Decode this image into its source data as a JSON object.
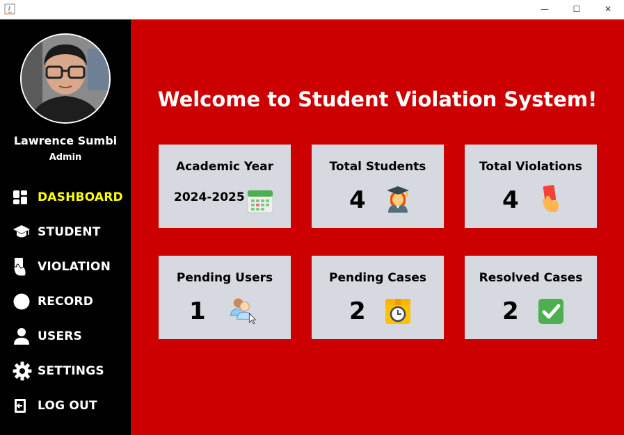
{
  "window": {
    "minimize_glyph": "—",
    "maximize_glyph": "☐",
    "close_glyph": "✕"
  },
  "sidebar": {
    "user_name": "Lawrence Sumbi",
    "user_role": "Admin",
    "items": [
      {
        "label": "DASHBOARD",
        "icon": "dashboard-icon",
        "active": true
      },
      {
        "label": "STUDENT",
        "icon": "graduation-cap-icon"
      },
      {
        "label": "VIOLATION",
        "icon": "hand-card-icon"
      },
      {
        "label": "RECORD",
        "icon": "record-circle-icon"
      },
      {
        "label": "USERS",
        "icon": "user-icon"
      },
      {
        "label": "SETTINGS",
        "icon": "gear-icon"
      },
      {
        "label": "LOG OUT",
        "icon": "logout-icon"
      }
    ],
    "active_color": "#ffff00"
  },
  "main": {
    "welcome": "Welcome to Student Violation System!",
    "background": "#cc0000",
    "cards": [
      {
        "title": "Academic Year",
        "value": "2024-2025",
        "icon": "calendar-icon"
      },
      {
        "title": "Total Students",
        "value": "4",
        "icon": "graduate-student-icon"
      },
      {
        "title": "Total Violations",
        "value": "4",
        "icon": "red-card-icon"
      },
      {
        "title": "Pending Users",
        "value": "1",
        "icon": "pending-users-icon"
      },
      {
        "title": "Pending Cases",
        "value": "2",
        "icon": "pending-box-clock-icon"
      },
      {
        "title": "Resolved Cases",
        "value": "2",
        "icon": "check-mark-icon"
      }
    ]
  }
}
